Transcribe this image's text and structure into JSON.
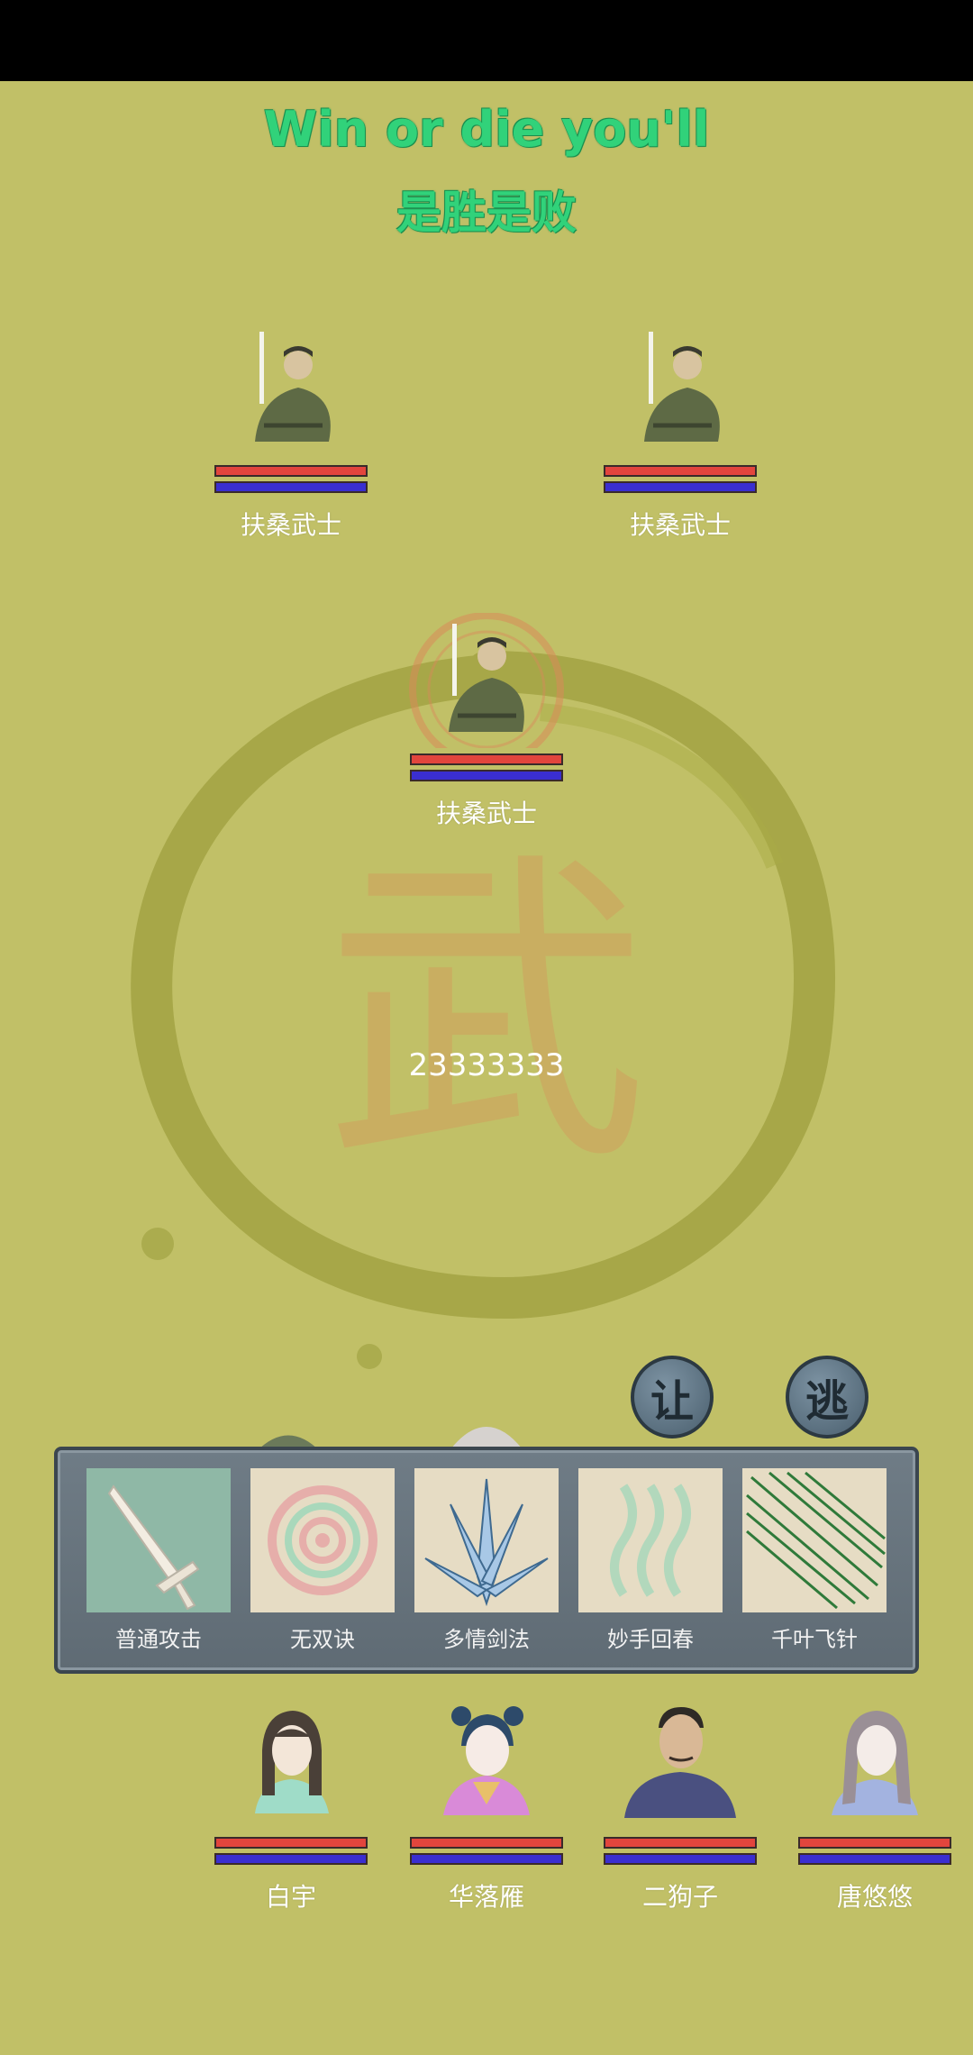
{
  "header": {
    "title_en": "Win or die you'll",
    "title_cn": "是胜是败"
  },
  "enemies": [
    {
      "name": "扶桑武士",
      "hp": 1.0,
      "mp": 1.0
    },
    {
      "name": "扶桑武士",
      "hp": 1.0,
      "mp": 1.0
    },
    {
      "name": "扶桑武士",
      "hp": 1.0,
      "mp": 1.0,
      "targeted": true
    }
  ],
  "battle": {
    "damage_text": "23333333"
  },
  "actions": {
    "yield_label": "让",
    "flee_label": "逃"
  },
  "skills": [
    {
      "label": "普通攻击",
      "icon": "sword-icon"
    },
    {
      "label": "无双诀",
      "icon": "spiral-icon"
    },
    {
      "label": "多情剑法",
      "icon": "blades-icon"
    },
    {
      "label": "妙手回春",
      "icon": "heal-wave-icon"
    },
    {
      "label": "千叶飞针",
      "icon": "needles-icon"
    }
  ],
  "party": [
    {
      "name": "白宇",
      "hp": 1.0,
      "mp": 1.0
    },
    {
      "name": "华落雁",
      "hp": 1.0,
      "mp": 1.0
    },
    {
      "name": "二狗子",
      "hp": 1.0,
      "mp": 1.0
    },
    {
      "name": "唐悠悠",
      "hp": 1.0,
      "mp": 1.0
    }
  ],
  "colors": {
    "background": "#c1c067",
    "title": "#31d27a",
    "hp": "#e2453d",
    "mp": "#3a2ed0"
  }
}
